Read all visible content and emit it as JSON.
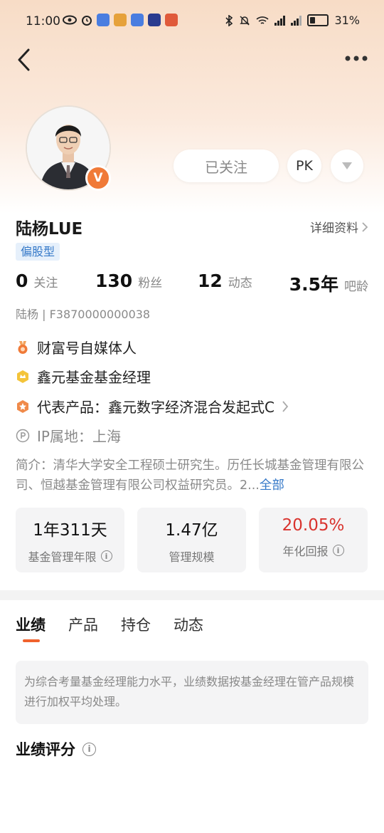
{
  "status_bar": {
    "time": "11:00",
    "battery": "31%"
  },
  "profile": {
    "name": "陆杨LUE",
    "tag": "偏股型",
    "detail_link": "详细资料",
    "follow_button": "已关注",
    "pk_button": "PK",
    "verified_badge": "V",
    "ident": "陆杨 | F3870000000038"
  },
  "stats": [
    {
      "num": "0",
      "label": "关注"
    },
    {
      "num": "130",
      "label": "粉丝"
    },
    {
      "num": "12",
      "label": "动态"
    },
    {
      "num": "3.5年",
      "label": "吧龄"
    }
  ],
  "info_rows": [
    {
      "icon": "medal-icon",
      "text": "财富号自媒体人"
    },
    {
      "icon": "crown-badge-icon",
      "text": "鑫元基金基金经理"
    },
    {
      "icon": "star-badge-icon",
      "text": "代表产品：鑫元数字经济混合发起式C"
    },
    {
      "icon": "ip-location-icon",
      "text": "IP属地：上海"
    }
  ],
  "intro": {
    "text": "简介：清华大学安全工程硕士研究生。历任长城基金管理有限公司、恒越基金管理有限公司权益研究员。2...",
    "more": "全部"
  },
  "cards": [
    {
      "value": "1年311天",
      "label": "基金管理年限"
    },
    {
      "value": "1.47亿",
      "label": "管理规模"
    },
    {
      "value": "20.05%",
      "label": "年化回报"
    }
  ],
  "tabs": [
    "业绩",
    "产品",
    "持仓",
    "动态"
  ],
  "notice": "为综合考量基金经理能力水平，业绩数据按基金经理在管产品规模进行加权平均处理。",
  "section_title": "业绩评分",
  "colors": {
    "accent": "#f0622d",
    "tag_blue": "#3478c8",
    "return_red": "#d9332e",
    "badge_orange": "#f07a38"
  }
}
